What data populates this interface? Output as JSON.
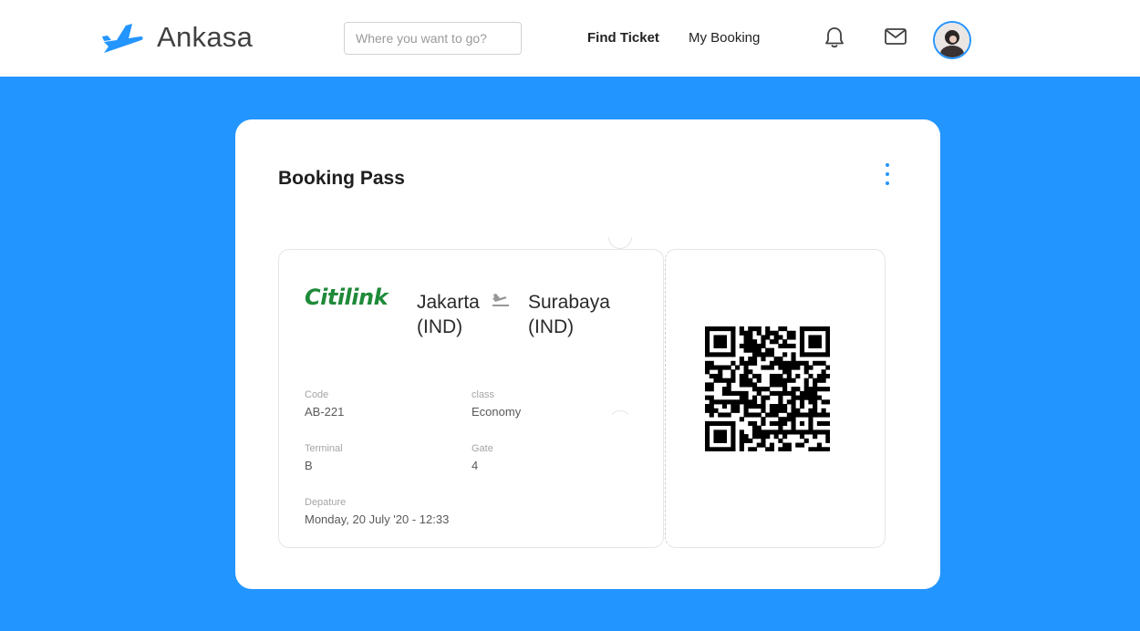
{
  "navbar": {
    "brand": "Ankasa",
    "search_placeholder": "Where you want to go?",
    "links": [
      {
        "label": "Find Ticket",
        "active": true
      },
      {
        "label": "My Booking",
        "active": false
      }
    ],
    "icons": [
      "airplane-logo-icon",
      "bell-icon",
      "mail-icon",
      "avatar"
    ]
  },
  "colors": {
    "primary": "#2395FF",
    "airline_green": "#1F8A3A",
    "text_dark": "#1e1e1e",
    "label_gray": "#A5A5A5"
  },
  "booking": {
    "title": "Booking Pass",
    "airline": "Citilink",
    "from": {
      "city": "Jakarta",
      "code": "(IND)"
    },
    "to": {
      "city": "Surabaya",
      "code": "(IND)"
    },
    "fields": {
      "code": {
        "label": "Code",
        "value": "AB-221"
      },
      "class": {
        "label": "class",
        "value": "Economy"
      },
      "terminal": {
        "label": "Terminal",
        "value": "B"
      },
      "gate": {
        "label": "Gate",
        "value": "4"
      },
      "departure": {
        "label": "Depature",
        "value": "Monday, 20 July '20 - 12:33"
      }
    }
  }
}
